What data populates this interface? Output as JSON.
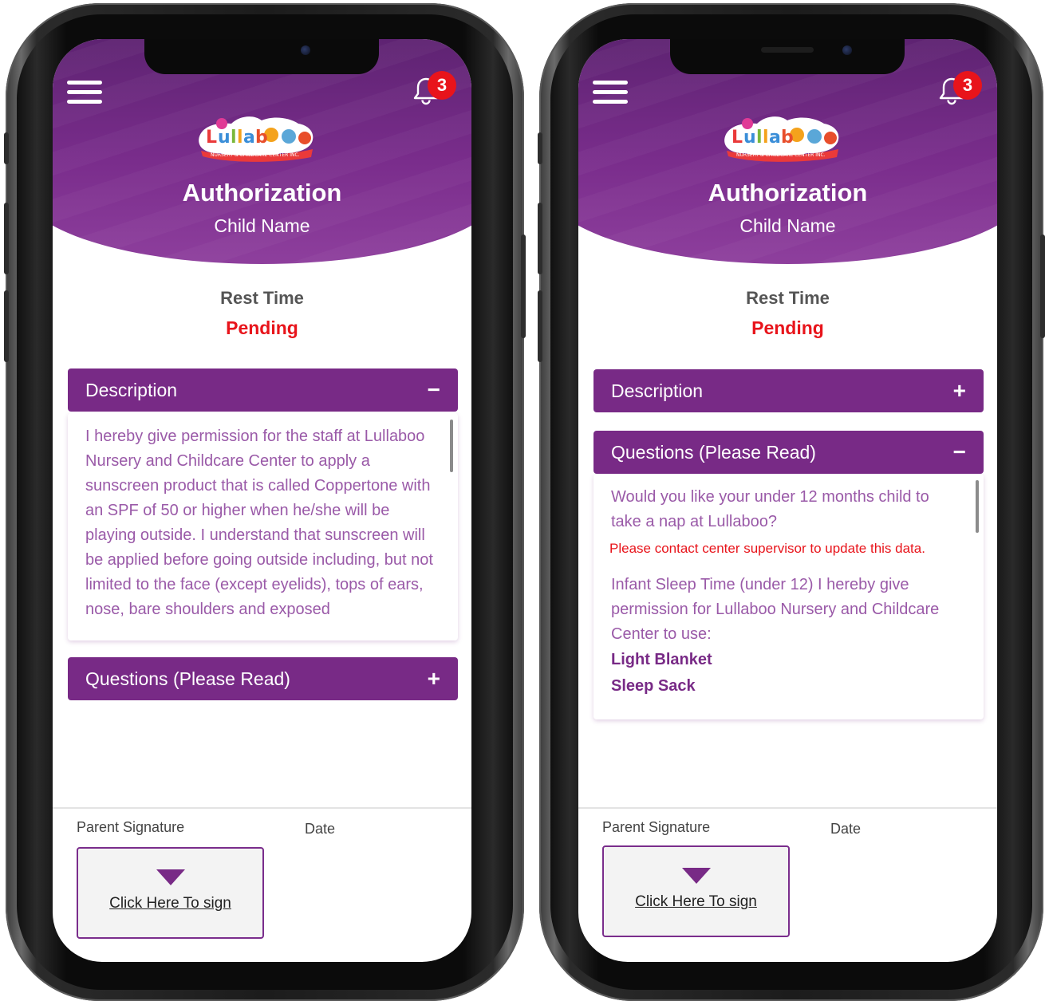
{
  "badge_count": "3",
  "logo_text": "Lullaboo",
  "logo_subtext": "NURSERY & CHILDCARE CENTER INC.",
  "header": {
    "title": "Authorization",
    "child_name": "Child Name"
  },
  "form": {
    "name": "Rest Time",
    "status": "Pending"
  },
  "colors": {
    "brand_purple": "#782a86",
    "status_red": "#e8141b",
    "text_purple": "#9a5aa8"
  },
  "screens": [
    {
      "description": {
        "label": "Description",
        "toggle": "−",
        "text": "I hereby give permission for the staff at Lullaboo Nursery and Childcare Center to apply a sunscreen product that is called Coppertone with an SPF of 50 or higher when he/she will be playing outside. I understand that sunscreen will be applied before going outside including, but not limited to the face (except eyelids), tops of ears, nose, bare shoulders and exposed"
      },
      "questions": {
        "label": "Questions  (Please Read)",
        "toggle": "+"
      }
    },
    {
      "description": {
        "label": "Description",
        "toggle": "+"
      },
      "questions": {
        "label": "Questions  (Please Read)",
        "toggle": "−",
        "question": "Would you like your under 12 months child to take a nap at Lullaboo?",
        "warning": "Please contact center supervisor to update this data.",
        "info": "Infant Sleep Time (under 12) I hereby give permission for Lullaboo Nursery and Childcare Center to use:",
        "options": [
          "Light Blanket",
          "Sleep Sack"
        ]
      }
    }
  ],
  "footer": {
    "signature_label": "Parent Signature",
    "date_label": "Date",
    "sign_link": "Click Here To sign"
  },
  "icons": [
    "menu-icon",
    "bell-icon",
    "collapse-icon",
    "expand-icon",
    "arrow-down-icon"
  ]
}
